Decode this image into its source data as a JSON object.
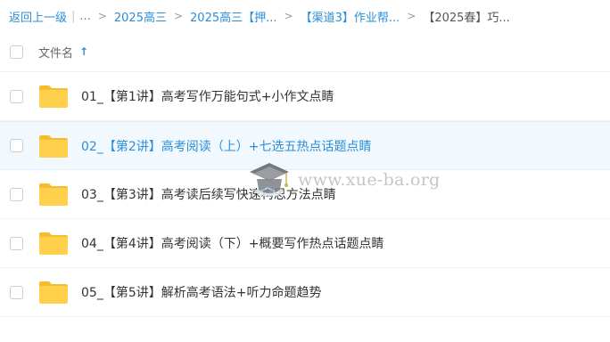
{
  "breadcrumb": {
    "back_label": "返回上一级",
    "bar": "|",
    "ellipsis": "...",
    "separator": ">",
    "items": [
      {
        "label": "2025高三"
      },
      {
        "label": "2025高三【押..."
      },
      {
        "label": "【渠道3】作业帮..."
      }
    ],
    "current": "【2025春】巧..."
  },
  "header": {
    "column_name": "文件名",
    "sort_icon": "arrow-up-icon"
  },
  "files": [
    {
      "name": "01_【第1讲】高考写作万能句式+小作文点睛",
      "icon": "folder-icon"
    },
    {
      "name": "02_【第2讲】高考阅读（上）+七选五热点话题点睛",
      "icon": "folder-icon"
    },
    {
      "name": "03_【第3讲】高考读后续写快速构思方法点睛",
      "icon": "folder-icon"
    },
    {
      "name": "04_【第4讲】高考阅读（下）+概要写作热点话题点睛",
      "icon": "folder-icon"
    },
    {
      "name": "05_【第5讲】解析高考语法+听力命题趋势",
      "icon": "folder-icon"
    }
  ],
  "watermark": {
    "text": "www.xue-ba.org",
    "icon": "graduation-cap-icon"
  },
  "colors": {
    "accent": "#2b8ed8",
    "folder": "#ffd04b",
    "folder_tab": "#f5bd2e",
    "hover_bg": "#f2f9fe"
  }
}
